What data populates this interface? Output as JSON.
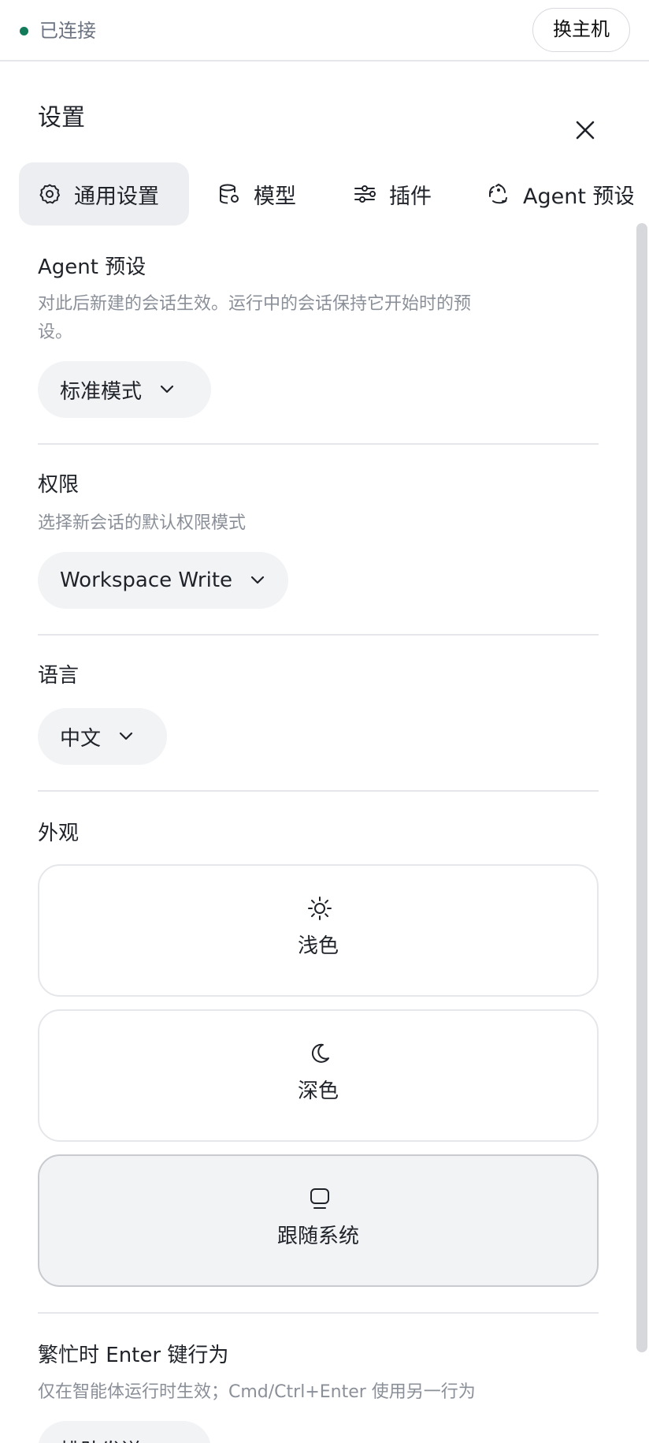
{
  "topbar": {
    "status_label": "已连接",
    "status_color": "#137a5a",
    "switch_host_label": "换主机"
  },
  "settings": {
    "title": "设置",
    "close_icon": "close-icon",
    "tabs": [
      {
        "label": "通用设置",
        "icon": "gear-icon",
        "active": true
      },
      {
        "label": "模型",
        "icon": "database-icon",
        "active": false
      },
      {
        "label": "插件",
        "icon": "sliders-icon",
        "active": false
      },
      {
        "label": "Agent 预设",
        "icon": "recycle-icon",
        "active": false
      }
    ],
    "agent_preset": {
      "title": "Agent 预设",
      "desc_line1": "对此后新建的会话生效。运行中的会话保持它开始时的预",
      "desc_line2": "设。",
      "value": "标准模式"
    },
    "permissions": {
      "title": "权限",
      "desc": "选择新会话的默认权限模式",
      "value": "Workspace Write"
    },
    "language": {
      "title": "语言",
      "value": "中文"
    },
    "appearance": {
      "title": "外观",
      "options": [
        {
          "label": "浅色",
          "icon": "sun-icon",
          "selected": false
        },
        {
          "label": "深色",
          "icon": "moon-icon",
          "selected": false
        },
        {
          "label": "跟随系统",
          "icon": "monitor-icon",
          "selected": true
        }
      ]
    },
    "busy_enter": {
      "title": "繁忙时 Enter 键行为",
      "desc": "仅在智能体运行时生效；Cmd/Ctrl+Enter 使用另一行为",
      "value": "排队发送"
    }
  }
}
